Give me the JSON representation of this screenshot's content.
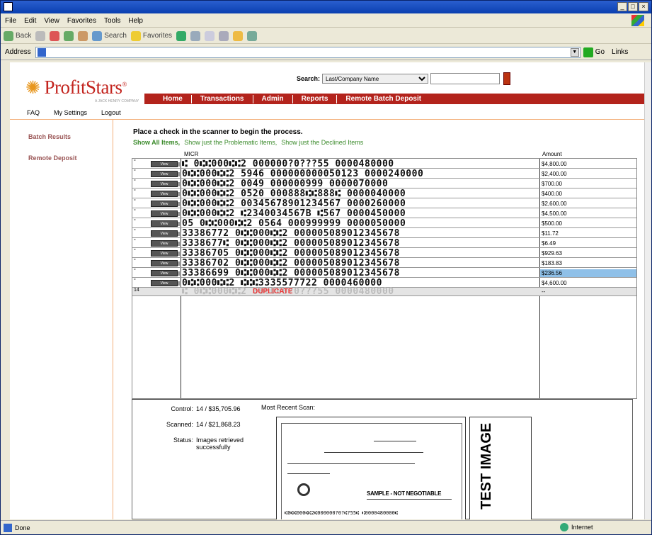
{
  "menu": [
    "File",
    "Edit",
    "View",
    "Favorites",
    "Tools",
    "Help"
  ],
  "toolbar": {
    "back": "Back",
    "search": "Search",
    "favorites": "Favorites"
  },
  "address": {
    "label": "Address",
    "go": "Go",
    "links": "Links"
  },
  "logo": {
    "name": "ProfitStars",
    "sub": "A JACK HENRY COMPANY"
  },
  "search": {
    "label": "Search:",
    "option": "Last/Company Name"
  },
  "nav": [
    "Home",
    "Transactions",
    "Admin",
    "Reports",
    "Remote Batch Deposit"
  ],
  "subnav": [
    "FAQ",
    "My Settings",
    "Logout"
  ],
  "sidebar": [
    "Batch Results",
    "Remote Deposit"
  ],
  "main": {
    "instruction": "Place a check in the scanner to begin the process.",
    "filters": [
      "Show All Items,",
      "Show just the Problematic Items,",
      "Show just the Declined Items"
    ],
    "col_micr": "MICR",
    "col_amount": "Amount",
    "view_label": "View",
    "rows": [
      {
        "micr": "⑆ 0⑆⑆000⑆⑆2 000000?0???55  0000480000",
        "amount": "$4,800.00"
      },
      {
        "micr": "0⑆⑆000⑆⑆2 5946 000000000050123  0000240000",
        "amount": "$2,400.00"
      },
      {
        "micr": "0⑆⑆000⑆⑆2 0049 000000999  0000070000",
        "amount": "$700.00"
      },
      {
        "micr": "0⑆⑆000⑆⑆2 0520 000888⑆⑆888⑆  0000040000",
        "amount": "$400.00"
      },
      {
        "micr": "0⑆⑆000⑆⑆2 00345678901234567  0000260000",
        "amount": "$2,600.00"
      },
      {
        "micr": "0⑆⑆000⑆⑆2 ⑆2340034567B ⑆567 0000450000",
        "amount": "$4,500.00"
      },
      {
        "micr": "05  0⑆⑆000⑆⑆2 0564 000999999  0000050000",
        "amount": "$500.00"
      },
      {
        "micr": "33386772  0⑆⑆000⑆⑆2 000005089012345678",
        "amount": "$11.72"
      },
      {
        "micr": "3338677⑆  0⑆⑆000⑆⑆2 000005089012345678",
        "amount": "$6.49"
      },
      {
        "micr": "33386705  0⑆⑆000⑆⑆2 000005089012345678",
        "amount": "$929.63"
      },
      {
        "micr": "33386702  0⑆⑆000⑆⑆2 000005089012345678",
        "amount": "$183.83"
      },
      {
        "micr": "33386699  0⑆⑆000⑆⑆2 000005089012345678",
        "amount": "$236.56",
        "selected": true
      },
      {
        "micr": "0⑆⑆000⑆⑆2 ⑆⑆⑆3335577722  0000460000",
        "amount": "$4,600.00"
      }
    ],
    "dup_index": "14",
    "dup_micr": "⑆ 0⑆⑆000⑆⑆2 000000?0???55  0000480000",
    "dup_label": "DUPLICATE",
    "dup_amount": "--"
  },
  "summary": {
    "control_label": "Control:",
    "control_value": "14 / $35,705.96",
    "scanned_label": "Scanned:",
    "scanned_value": "14 / $21,868.23",
    "status_label": "Status:",
    "status_value": "Images retrieved successfully",
    "recent_label": "Most Recent Scan:",
    "check_text": "SAMPLE - NOT NEGOTIABLE",
    "check_micr": "⑆0⑆⑆000⑆⑆2⑆000000?0?⑆?55⑆     ⑆0000480000⑆",
    "test_image": "TEST IMAGE"
  },
  "status": {
    "done": "Done",
    "zone": "Internet"
  }
}
